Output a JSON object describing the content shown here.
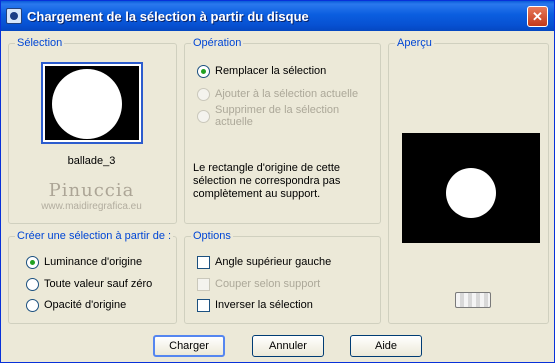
{
  "window": {
    "title": "Chargement de la sélection à partir du disque",
    "close_glyph": "✕",
    "icon": "app-icon"
  },
  "selection": {
    "legend": "Sélection",
    "thumbnail_caption": "ballade_3"
  },
  "watermark": {
    "name": "Pinuccia",
    "url": "www.maidiregrafica.eu"
  },
  "operation": {
    "legend": "Opération",
    "options": [
      {
        "label": "Remplacer la sélection",
        "checked": true,
        "enabled": true
      },
      {
        "label": "Ajouter à la sélection actuelle",
        "checked": false,
        "enabled": false
      },
      {
        "label": "Supprimer de la sélection actuelle",
        "checked": false,
        "enabled": false
      }
    ],
    "note": "Le rectangle d'origine de cette sélection ne correspondra pas complètement au support."
  },
  "preview": {
    "legend": "Aperçu"
  },
  "create_from": {
    "legend": "Créer une sélection à partir de :",
    "options": [
      {
        "label": "Luminance d'origine",
        "checked": true
      },
      {
        "label": "Toute valeur sauf zéro",
        "checked": false
      },
      {
        "label": "Opacité d'origine",
        "checked": false
      }
    ]
  },
  "options": {
    "legend": "Options",
    "checkboxes": [
      {
        "label": "Angle supérieur gauche",
        "checked": false,
        "enabled": true
      },
      {
        "label": "Couper selon support",
        "checked": false,
        "enabled": false
      },
      {
        "label": "Inverser la sélection",
        "checked": false,
        "enabled": true
      }
    ]
  },
  "buttons": {
    "load": "Charger",
    "cancel": "Annuler",
    "help": "Aide"
  }
}
